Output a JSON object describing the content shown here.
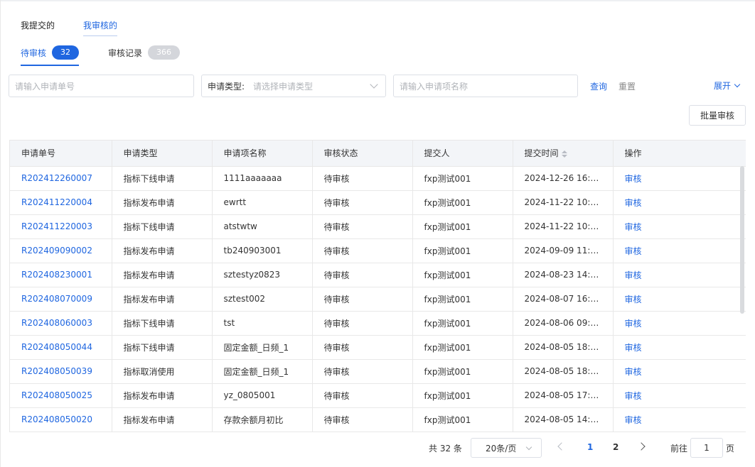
{
  "tabs": [
    {
      "label": "我提交的",
      "active": false
    },
    {
      "label": "我审核的",
      "active": true
    }
  ],
  "sub_tabs": [
    {
      "label": "待审核",
      "count": "32",
      "active": true
    },
    {
      "label": "审核记录",
      "count": "366",
      "active": false
    }
  ],
  "filters": {
    "apply_no_placeholder": "请输入申请单号",
    "apply_type_label": "申请类型:",
    "apply_type_placeholder": "请选择申请类型",
    "item_name_placeholder": "请输入申请项名称",
    "query": "查询",
    "reset": "重置",
    "expand": "展开"
  },
  "batch_button": "批量审核",
  "table": {
    "columns": [
      "申请单号",
      "申请类型",
      "申请项名称",
      "审核状态",
      "提交人",
      "提交时间",
      "操作"
    ],
    "rows": [
      [
        "R202412260007",
        "指标下线申请",
        "1111aaaaaaa",
        "待审核",
        "fxp测试001",
        "2024-12-26 16:13...",
        "审核"
      ],
      [
        "R202411220004",
        "指标发布申请",
        "ewrtt",
        "待审核",
        "fxp测试001",
        "2024-11-22 10:45...",
        "审核"
      ],
      [
        "R202411220003",
        "指标下线申请",
        "atstwtw",
        "待审核",
        "fxp测试001",
        "2024-11-22 10:43...",
        "审核"
      ],
      [
        "R202409090002",
        "指标发布申请",
        "tb240903001",
        "待审核",
        "fxp测试001",
        "2024-09-09 11:24...",
        "审核"
      ],
      [
        "R202408230001",
        "指标发布申请",
        "sztestyz0823",
        "待审核",
        "fxp测试001",
        "2024-08-23 14:38...",
        "审核"
      ],
      [
        "R202408070009",
        "指标发布申请",
        "sztest002",
        "待审核",
        "fxp测试001",
        "2024-08-07 16:52...",
        "审核"
      ],
      [
        "R202408060003",
        "指标下线申请",
        "tst",
        "待审核",
        "fxp测试001",
        "2024-08-06 09:42...",
        "审核"
      ],
      [
        "R202408050044",
        "指标下线申请",
        "固定金额_日频_1",
        "待审核",
        "fxp测试001",
        "2024-08-05 18:35...",
        "审核"
      ],
      [
        "R202408050039",
        "指标取消使用",
        "固定金额_日频_1",
        "待审核",
        "fxp测试001",
        "2024-08-05 18:13...",
        "审核"
      ],
      [
        "R202408050025",
        "指标发布申请",
        "yz_0805001",
        "待审核",
        "fxp测试001",
        "2024-08-05 17:30...",
        "审核"
      ],
      [
        "R202408050020",
        "指标发布申请",
        "存款余额月初比",
        "待审核",
        "fxp测试001",
        "2024-08-05 14:31...",
        "审核"
      ],
      [
        "",
        "",
        "",
        "",
        "",
        "",
        ""
      ]
    ]
  },
  "pagination": {
    "total": "共 32 条",
    "page_size": "20条/页",
    "pages": [
      "1",
      "2"
    ],
    "current_page": 1,
    "goto_label": "前往",
    "goto_value": "1",
    "goto_unit": "页"
  },
  "colors": {
    "accent": "#1f66e0",
    "badge_gray": "#d4d6db",
    "header_bg": "#f3f5f8"
  }
}
